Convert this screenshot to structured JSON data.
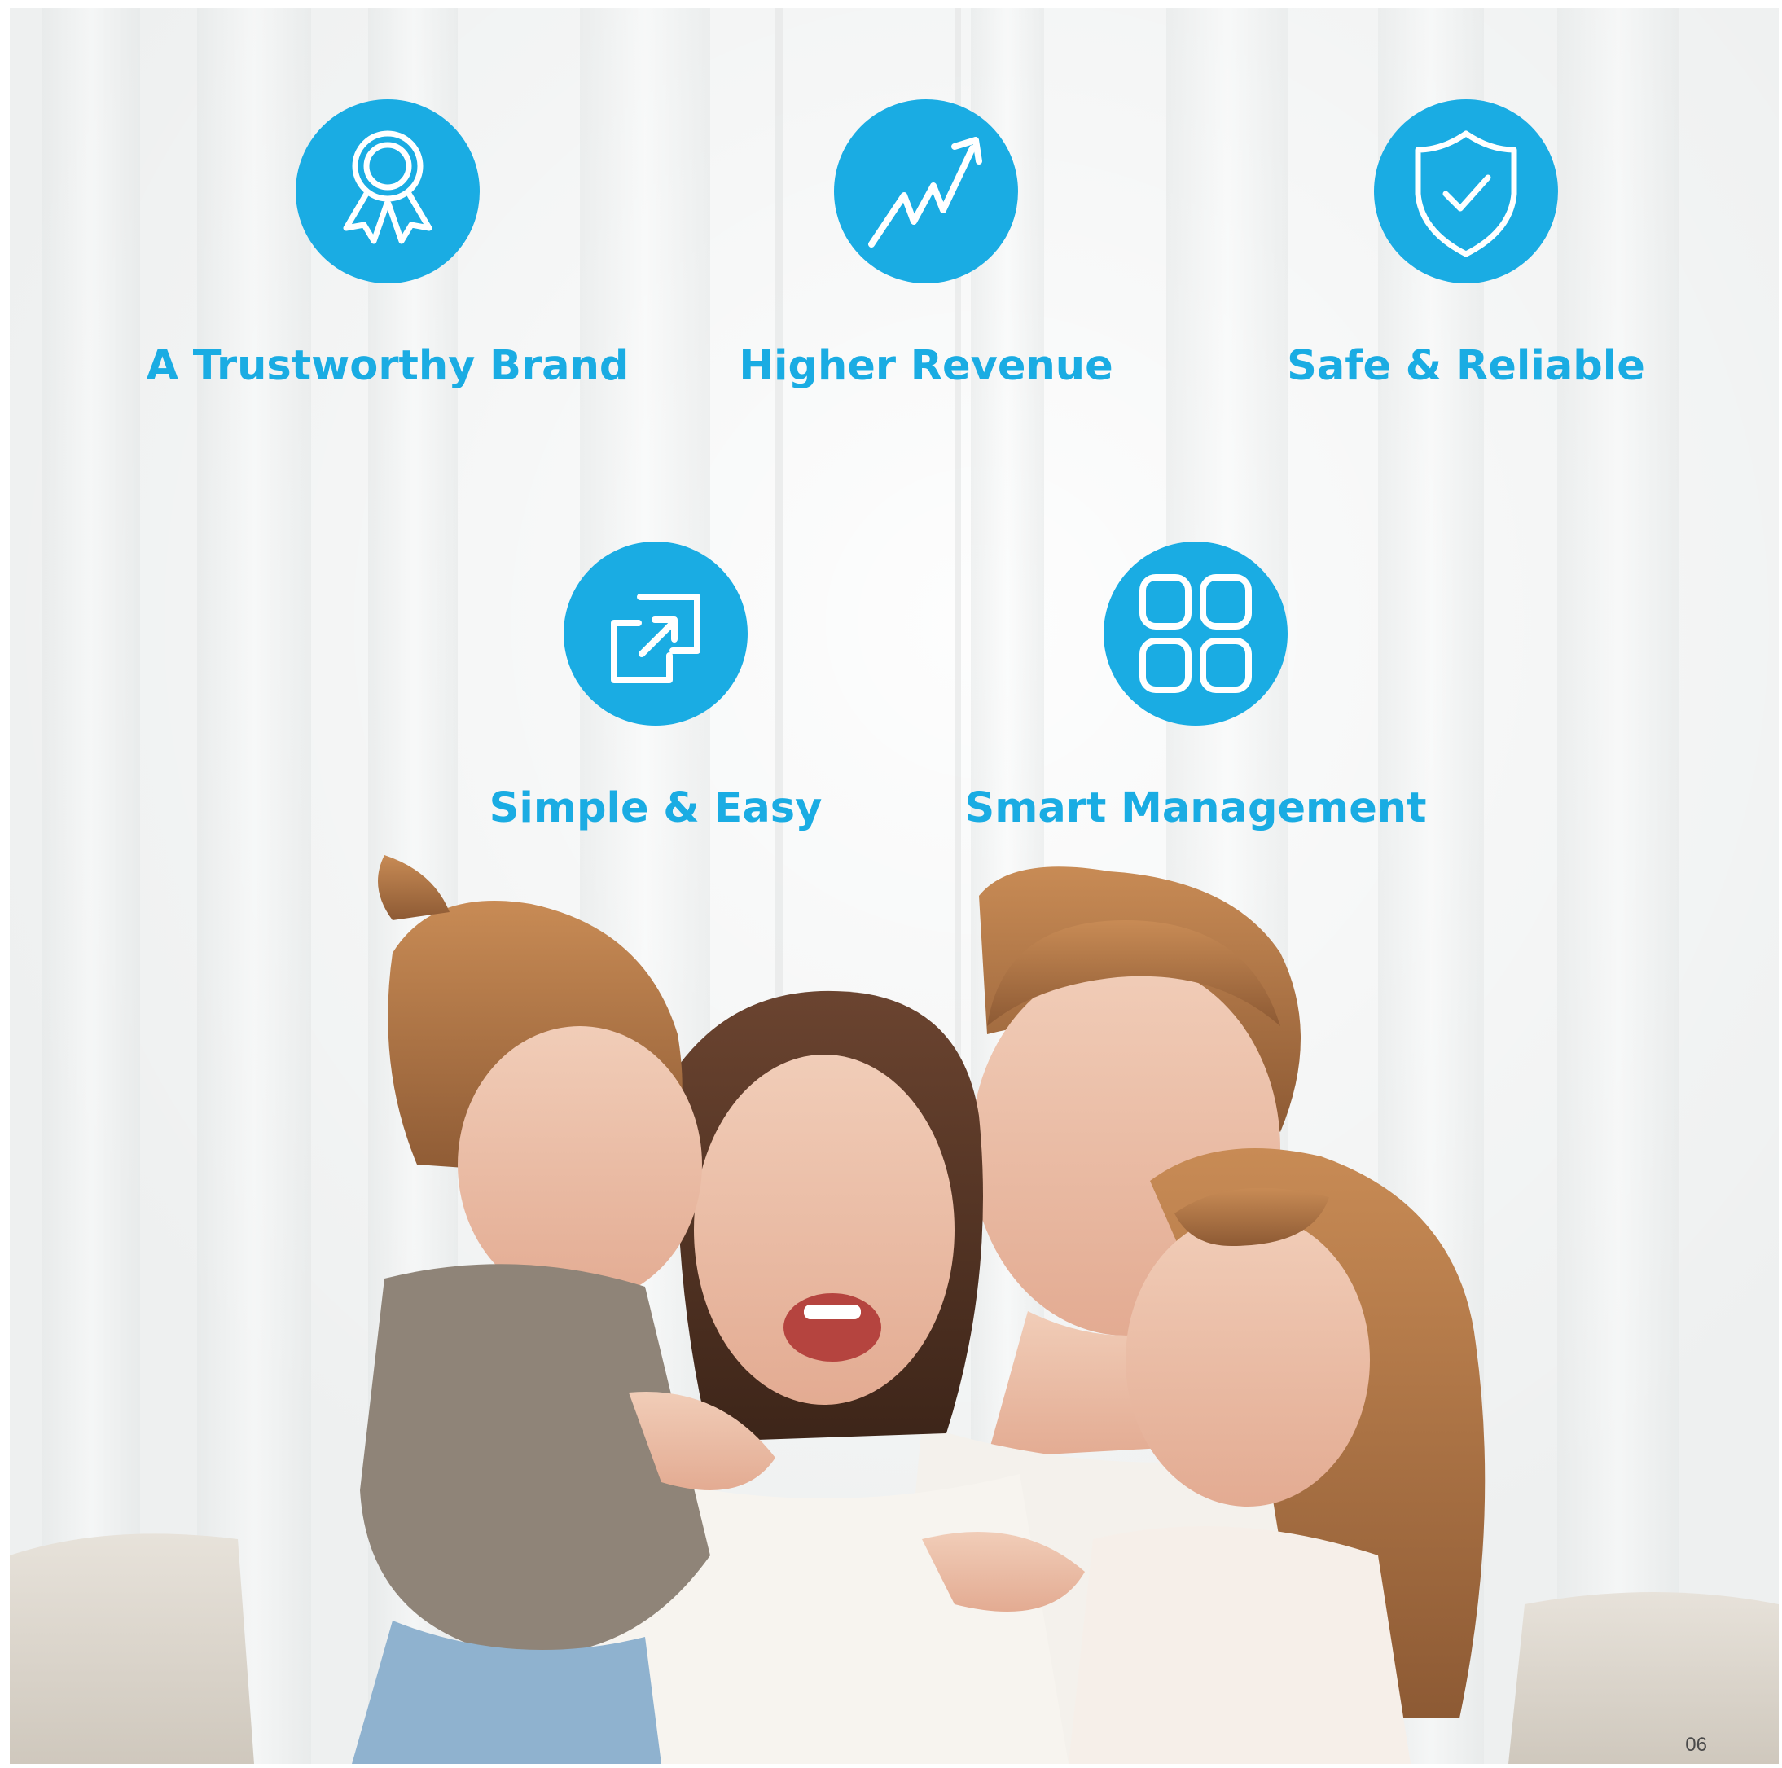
{
  "colors": {
    "accent": "#1aace3",
    "icon_stroke": "#ffffff"
  },
  "features": [
    {
      "label": "A Trustworthy Brand",
      "icon": "award-ribbon-icon"
    },
    {
      "label": "Higher Revenue",
      "icon": "trending-up-icon"
    },
    {
      "label": "Safe & Reliable",
      "icon": "shield-check-icon"
    },
    {
      "label": "Simple & Easy",
      "icon": "external-link-icon"
    },
    {
      "label": "Smart Management",
      "icon": "grid-apps-icon"
    }
  ],
  "photo": {
    "subject": "family-hug-photo"
  },
  "page_number": "06"
}
